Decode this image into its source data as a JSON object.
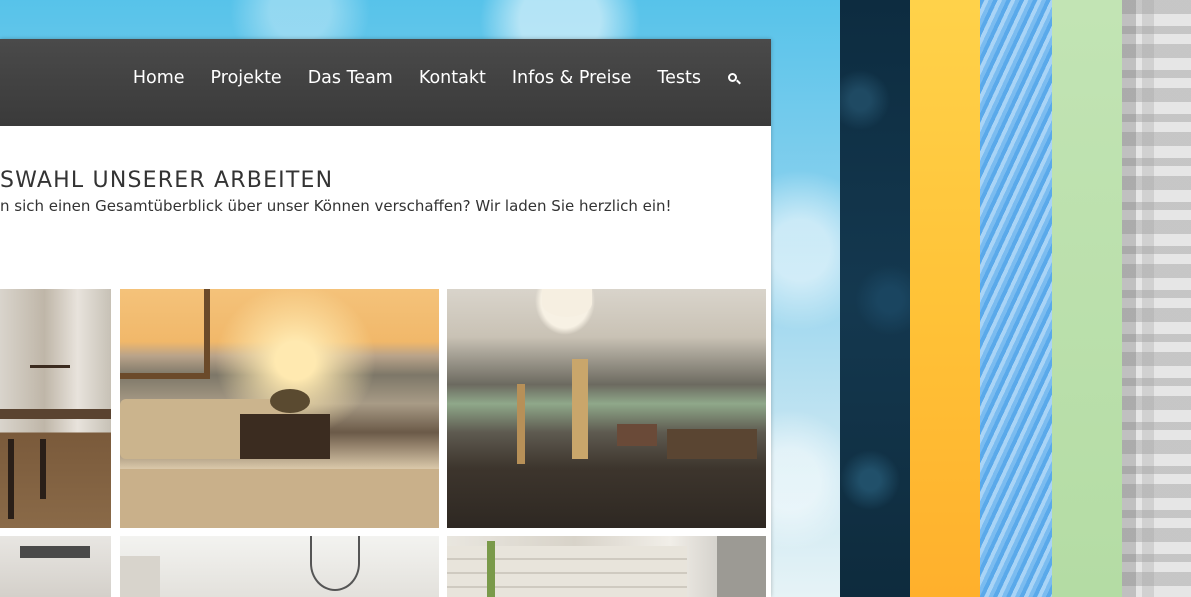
{
  "nav": {
    "items": [
      "Home",
      "Projekte",
      "Das Team",
      "Kontakt",
      "Infos & Preise",
      "Tests"
    ],
    "search_icon": "search-icon"
  },
  "section": {
    "title": "SWAHL UNSERER ARBEITEN",
    "subtitle": "n sich einen Gesamtüberblick über unser Können verschaffen? Wir laden Sie herzlich ein!"
  },
  "gallery": {
    "images": [
      "kitchen-interior",
      "rooftop-terrace-sunset",
      "open-living-room",
      "modern-kitchen",
      "chandelier-room",
      "stone-wall-room"
    ]
  },
  "swatches": {
    "colors": [
      "#0d2c40",
      "#ffc338",
      "#7bbcf0",
      "#b4dca4",
      "#e6e6e6"
    ]
  }
}
